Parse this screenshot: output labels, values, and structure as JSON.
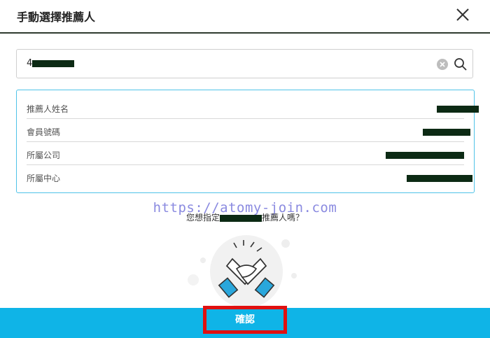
{
  "dialog": {
    "title": "手動選擇推薦人"
  },
  "search": {
    "value": "4"
  },
  "recommender_info": {
    "rows": [
      {
        "label": "推薦人姓名"
      },
      {
        "label": "會員號碼"
      },
      {
        "label": "所屬公司"
      },
      {
        "label": "所屬中心"
      }
    ]
  },
  "watermark": "https://atomy-join.com",
  "confirm_question": {
    "prefix": "您想指定",
    "suffix": "推薦人嗎？"
  },
  "confirm_button": {
    "label": "確認"
  },
  "icons": {
    "close": "close-icon",
    "clear": "clear-icon",
    "search": "search-icon",
    "handshake": "handshake-icon"
  },
  "colors": {
    "accent_blue": "#0fb4e7",
    "info_border": "#4fc3e8",
    "highlight_red": "#e01010",
    "redaction": "#0c2a14"
  }
}
